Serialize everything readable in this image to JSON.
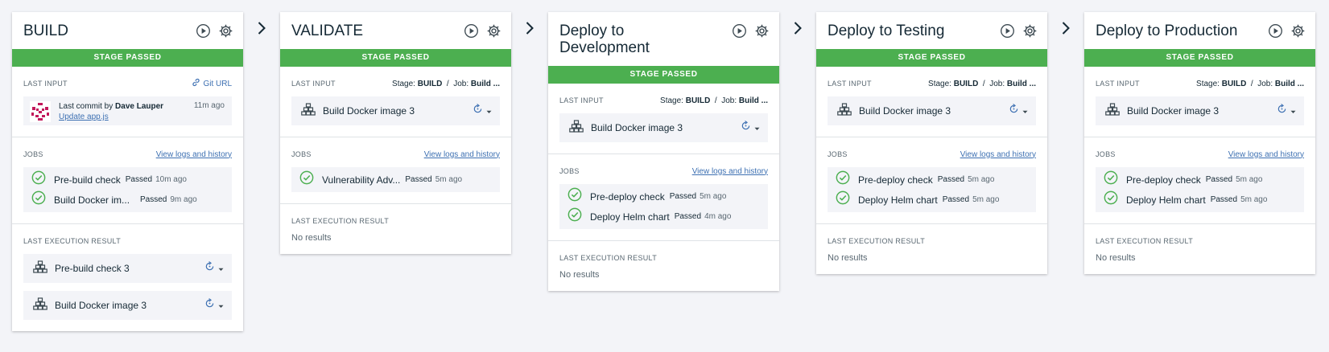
{
  "labels": {
    "banner": "STAGE PASSED",
    "last_input": "LAST INPUT",
    "jobs": "JOBS",
    "last_execution": "LAST EXECUTION RESULT",
    "view_logs": "View logs and history",
    "no_results": "No results",
    "git_url": "Git URL",
    "stage_prefix": "Stage:",
    "job_prefix": "Job:"
  },
  "colors": {
    "passed": "#4caf50",
    "link": "#3d70b2",
    "text": "#152935",
    "muted": "#5a6872",
    "background": "#f3f4f8"
  },
  "icons": {
    "run": "play-circle-icon",
    "settings": "gear-icon",
    "arrow": "chevron-right-icon",
    "input": "docker-stack-icon",
    "rerun": "rerun-icon",
    "passed": "check-circle-icon"
  },
  "stages": [
    {
      "title": "BUILD",
      "commit": {
        "prefix": "Last commit by",
        "author": "Dave Lauper",
        "message": "Update app.js",
        "time": "11m ago"
      },
      "jobs": [
        {
          "name": "Pre-build check",
          "status": "Passed",
          "time": "10m ago"
        },
        {
          "name": "Build Docker im...",
          "status": "Passed",
          "time": "9m ago"
        }
      ],
      "executions": [
        "Pre-build check 3",
        "Build Docker image 3"
      ]
    },
    {
      "title": "VALIDATE",
      "input": {
        "stage": "BUILD",
        "job": "Build ...",
        "label": "Build Docker image 3"
      },
      "jobs": [
        {
          "name": "Vulnerability Adv...",
          "status": "Passed",
          "time": "5m ago"
        }
      ]
    },
    {
      "title": "Deploy to Development",
      "input": {
        "stage": "BUILD",
        "job": "Build ...",
        "label": "Build Docker image 3"
      },
      "jobs": [
        {
          "name": "Pre-deploy check",
          "status": "Passed",
          "time": "5m ago"
        },
        {
          "name": "Deploy Helm chart",
          "status": "Passed",
          "time": "4m ago"
        }
      ]
    },
    {
      "title": "Deploy to Testing",
      "input": {
        "stage": "BUILD",
        "job": "Build ...",
        "label": "Build Docker image 3"
      },
      "jobs": [
        {
          "name": "Pre-deploy check",
          "status": "Passed",
          "time": "5m ago"
        },
        {
          "name": "Deploy Helm chart",
          "status": "Passed",
          "time": "5m ago"
        }
      ]
    },
    {
      "title": "Deploy to Production",
      "input": {
        "stage": "BUILD",
        "job": "Build ...",
        "label": "Build Docker image 3"
      },
      "jobs": [
        {
          "name": "Pre-deploy check",
          "status": "Passed",
          "time": "5m ago"
        },
        {
          "name": "Deploy Helm chart",
          "status": "Passed",
          "time": "5m ago"
        }
      ]
    }
  ]
}
